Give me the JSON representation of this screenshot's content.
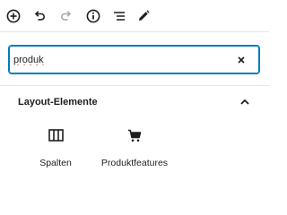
{
  "toolbar": {
    "buttons": [
      {
        "icon": "add-block-icon"
      },
      {
        "icon": "undo-icon"
      },
      {
        "icon": "redo-icon"
      },
      {
        "icon": "info-icon"
      },
      {
        "icon": "outline-list-icon"
      },
      {
        "icon": "edit-pencil-icon"
      }
    ]
  },
  "search": {
    "value": "produk",
    "clear_icon": "close-icon"
  },
  "panel": {
    "title": "Layout-Elemente",
    "chevron_icon": "chevron-up-icon",
    "blocks": [
      {
        "label": "Spalten",
        "icon": "columns-icon"
      },
      {
        "label": "Produktfeatures",
        "icon": "cart-icon"
      }
    ]
  },
  "colors": {
    "accent": "#007cba",
    "text": "#1e1e1e",
    "divider": "#e2e4e7",
    "disabled": "#a7aaad",
    "spellcheck": "#d63638"
  }
}
